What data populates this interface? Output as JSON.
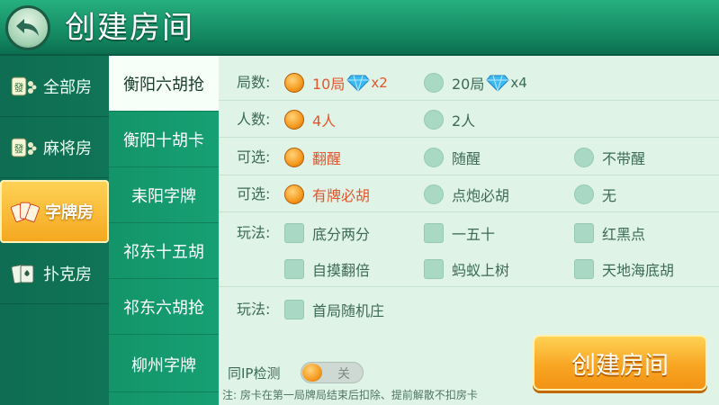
{
  "header": {
    "title": "创建房间"
  },
  "sidebar": {
    "items": [
      {
        "label": "全部房",
        "icon": "mahjong-tile-icon",
        "active": false
      },
      {
        "label": "麻将房",
        "icon": "mahjong-tile-icon",
        "active": false
      },
      {
        "label": "字牌房",
        "icon": "card-fan-icon",
        "active": true
      },
      {
        "label": "扑克房",
        "icon": "playing-cards-icon",
        "active": false
      }
    ]
  },
  "games": [
    {
      "label": "衡阳六胡抢",
      "active": true
    },
    {
      "label": "衡阳十胡卡",
      "active": false
    },
    {
      "label": "耒阳字牌",
      "active": false
    },
    {
      "label": "祁东十五胡",
      "active": false
    },
    {
      "label": "祁东六胡抢",
      "active": false
    },
    {
      "label": "柳州字牌",
      "active": false
    }
  ],
  "options": {
    "rounds": {
      "label": "局数:",
      "choices": [
        {
          "text": "10局",
          "mult": "x2",
          "selected": true
        },
        {
          "text": "20局",
          "mult": "x4",
          "selected": false
        }
      ]
    },
    "players": {
      "label": "人数:",
      "choices": [
        {
          "text": "4人",
          "selected": true
        },
        {
          "text": "2人",
          "selected": false
        }
      ]
    },
    "optional1": {
      "label": "可选:",
      "choices": [
        {
          "text": "翻醒",
          "selected": true
        },
        {
          "text": "随醒",
          "selected": false
        },
        {
          "text": "不带醒",
          "selected": false
        }
      ]
    },
    "optional2": {
      "label": "可选:",
      "choices": [
        {
          "text": "有牌必胡",
          "selected": true
        },
        {
          "text": "点炮必胡",
          "selected": false
        },
        {
          "text": "无",
          "selected": false
        }
      ]
    },
    "play1": {
      "label": "玩法:",
      "choices": [
        "底分两分",
        "一五十",
        "红黑点",
        "自摸翻倍",
        "蚂蚁上树",
        "天地海底胡"
      ]
    },
    "play2": {
      "label": "玩法:",
      "choices": [
        "首局随机庄"
      ]
    }
  },
  "ip_check": {
    "label": "同IP检测",
    "state": "关"
  },
  "note": "注: 房卡在第一局牌局结束后扣除、提前解散不扣房卡",
  "create_button": {
    "label": "创建房间"
  },
  "colors": {
    "accent_orange": "#f59a1f",
    "header_green": "#12865f",
    "panel_bg": "#dff3e6",
    "selected_text": "#e2562e"
  }
}
